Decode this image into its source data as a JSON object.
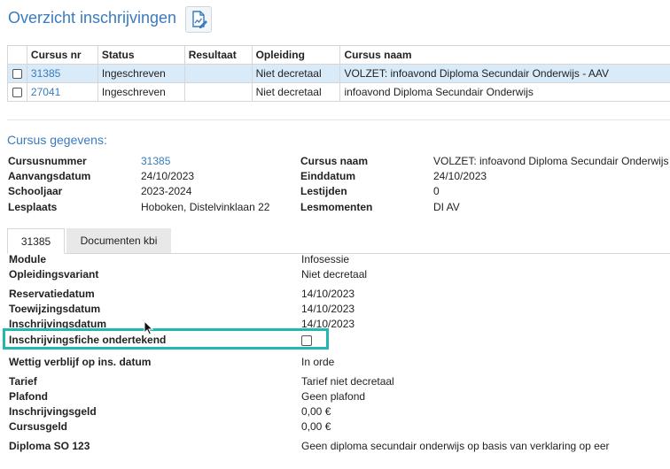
{
  "title": "Overzicht inschrijvingen",
  "table": {
    "headers": [
      "Cursus nr",
      "Status",
      "Resultaat",
      "Opleiding",
      "Cursus naam"
    ],
    "rows": [
      {
        "cursus_nr": "31385",
        "status": "Ingeschreven",
        "resultaat": "",
        "opleiding": "Niet decretaal",
        "cursus_naam": "VOLZET: infoavond Diploma Secundair Onderwijs - AAV"
      },
      {
        "cursus_nr": "27041",
        "status": "Ingeschreven",
        "resultaat": "",
        "opleiding": "Niet decretaal",
        "cursus_naam": "infoavond Diploma Secundair Onderwijs"
      }
    ]
  },
  "gegevens": {
    "title": "Cursus gegevens:",
    "left": [
      {
        "label": "Cursusnummer",
        "value": "31385"
      },
      {
        "label": "Aanvangsdatum",
        "value": "24/10/2023"
      },
      {
        "label": "Schooljaar",
        "value": "2023-2024"
      },
      {
        "label": "Lesplaats",
        "value": "Hoboken, Distelvinklaan 22"
      }
    ],
    "right": [
      {
        "label": "Cursus naam",
        "value": "VOLZET: infoavond Diploma Secundair Onderwijs"
      },
      {
        "label": "Einddatum",
        "value": "24/10/2023"
      },
      {
        "label": "Lestijden",
        "value": "0"
      },
      {
        "label": "Lesmomenten",
        "value": "DI AV"
      }
    ]
  },
  "tabs": [
    "31385",
    "Documenten kbi"
  ],
  "details": [
    {
      "label": "Module",
      "value": "Infosessie"
    },
    {
      "label": "Opleidingsvariant",
      "value": "Niet decretaal"
    },
    {
      "label": "Reservatiedatum",
      "value": "14/10/2023"
    },
    {
      "label": "Toewijzingsdatum",
      "value": "14/10/2023"
    },
    {
      "label": "Inschrijvingsdatum",
      "value": "14/10/2023"
    },
    {
      "label": "Inschrijvingsfiche ondertekend",
      "value": ""
    },
    {
      "label": "Wettig verblijf op ins. datum",
      "value": "In orde"
    },
    {
      "label": "Tarief",
      "value": "Tarief niet decretaal"
    },
    {
      "label": "Plafond",
      "value": "Geen plafond"
    },
    {
      "label": "Inschrijvingsgeld",
      "value": "0,00 €"
    },
    {
      "label": "Cursusgeld",
      "value": "0,00 €"
    },
    {
      "label": "Diploma SO 123",
      "value": "Geen diploma secundair onderwijs op basis van verklaring op eer"
    }
  ],
  "colors": {
    "accent": "#3a7bbf",
    "selected_row": "#d9ebf9",
    "highlight": "#23b7b0"
  },
  "icons": {
    "title_icon": "edit-document-icon",
    "cursor": "mouse-pointer-icon"
  }
}
